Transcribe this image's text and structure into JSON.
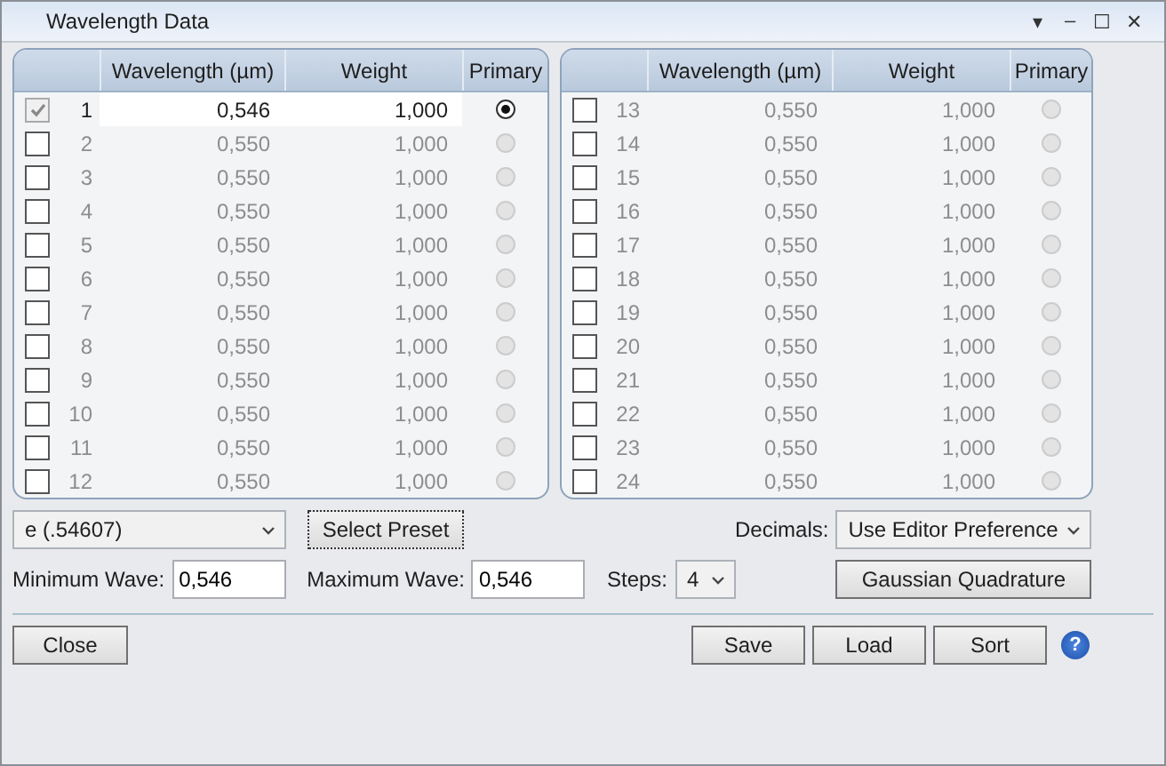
{
  "window": {
    "title": "Wavelength Data",
    "controls": [
      "▾",
      "–",
      "☐",
      "✕"
    ]
  },
  "tables": [
    {
      "columns": [
        "Wavelength (µm)",
        "Weight",
        "Primary"
      ],
      "rows": [
        {
          "number": "1",
          "wavelength": "0,546",
          "weight": "1,000",
          "checked": true,
          "enabled": true,
          "selected": true
        },
        {
          "number": "2",
          "wavelength": "0,550",
          "weight": "1,000",
          "checked": false,
          "enabled": false,
          "selected": false
        },
        {
          "number": "3",
          "wavelength": "0,550",
          "weight": "1,000",
          "checked": false,
          "enabled": false,
          "selected": false
        },
        {
          "number": "4",
          "wavelength": "0,550",
          "weight": "1,000",
          "checked": false,
          "enabled": false,
          "selected": false
        },
        {
          "number": "5",
          "wavelength": "0,550",
          "weight": "1,000",
          "checked": false,
          "enabled": false,
          "selected": false
        },
        {
          "number": "6",
          "wavelength": "0,550",
          "weight": "1,000",
          "checked": false,
          "enabled": false,
          "selected": false
        },
        {
          "number": "7",
          "wavelength": "0,550",
          "weight": "1,000",
          "checked": false,
          "enabled": false,
          "selected": false
        },
        {
          "number": "8",
          "wavelength": "0,550",
          "weight": "1,000",
          "checked": false,
          "enabled": false,
          "selected": false
        },
        {
          "number": "9",
          "wavelength": "0,550",
          "weight": "1,000",
          "checked": false,
          "enabled": false,
          "selected": false
        },
        {
          "number": "10",
          "wavelength": "0,550",
          "weight": "1,000",
          "checked": false,
          "enabled": false,
          "selected": false
        },
        {
          "number": "11",
          "wavelength": "0,550",
          "weight": "1,000",
          "checked": false,
          "enabled": false,
          "selected": false
        },
        {
          "number": "12",
          "wavelength": "0,550",
          "weight": "1,000",
          "checked": false,
          "enabled": false,
          "selected": false
        }
      ]
    },
    {
      "columns": [
        "Wavelength (µm)",
        "Weight",
        "Primary"
      ],
      "rows": [
        {
          "number": "13",
          "wavelength": "0,550",
          "weight": "1,000",
          "checked": false,
          "enabled": false,
          "selected": false
        },
        {
          "number": "14",
          "wavelength": "0,550",
          "weight": "1,000",
          "checked": false,
          "enabled": false,
          "selected": false
        },
        {
          "number": "15",
          "wavelength": "0,550",
          "weight": "1,000",
          "checked": false,
          "enabled": false,
          "selected": false
        },
        {
          "number": "16",
          "wavelength": "0,550",
          "weight": "1,000",
          "checked": false,
          "enabled": false,
          "selected": false
        },
        {
          "number": "17",
          "wavelength": "0,550",
          "weight": "1,000",
          "checked": false,
          "enabled": false,
          "selected": false
        },
        {
          "number": "18",
          "wavelength": "0,550",
          "weight": "1,000",
          "checked": false,
          "enabled": false,
          "selected": false
        },
        {
          "number": "19",
          "wavelength": "0,550",
          "weight": "1,000",
          "checked": false,
          "enabled": false,
          "selected": false
        },
        {
          "number": "20",
          "wavelength": "0,550",
          "weight": "1,000",
          "checked": false,
          "enabled": false,
          "selected": false
        },
        {
          "number": "21",
          "wavelength": "0,550",
          "weight": "1,000",
          "checked": false,
          "enabled": false,
          "selected": false
        },
        {
          "number": "22",
          "wavelength": "0,550",
          "weight": "1,000",
          "checked": false,
          "enabled": false,
          "selected": false
        },
        {
          "number": "23",
          "wavelength": "0,550",
          "weight": "1,000",
          "checked": false,
          "enabled": false,
          "selected": false
        },
        {
          "number": "24",
          "wavelength": "0,550",
          "weight": "1,000",
          "checked": false,
          "enabled": false,
          "selected": false
        }
      ]
    }
  ],
  "preset": {
    "value": "e (.54607)",
    "button": "Select Preset"
  },
  "decimals": {
    "label": "Decimals:",
    "value": "Use Editor Preference"
  },
  "min_wave": {
    "label": "Minimum Wave:",
    "value": "0,546"
  },
  "max_wave": {
    "label": "Maximum Wave:",
    "value": "0,546"
  },
  "steps": {
    "label": "Steps:",
    "value": "4"
  },
  "gaussian_button": "Gaussian Quadrature",
  "footer": {
    "close": "Close",
    "buttons": [
      "Save",
      "Load",
      "Sort"
    ],
    "help": "?"
  }
}
